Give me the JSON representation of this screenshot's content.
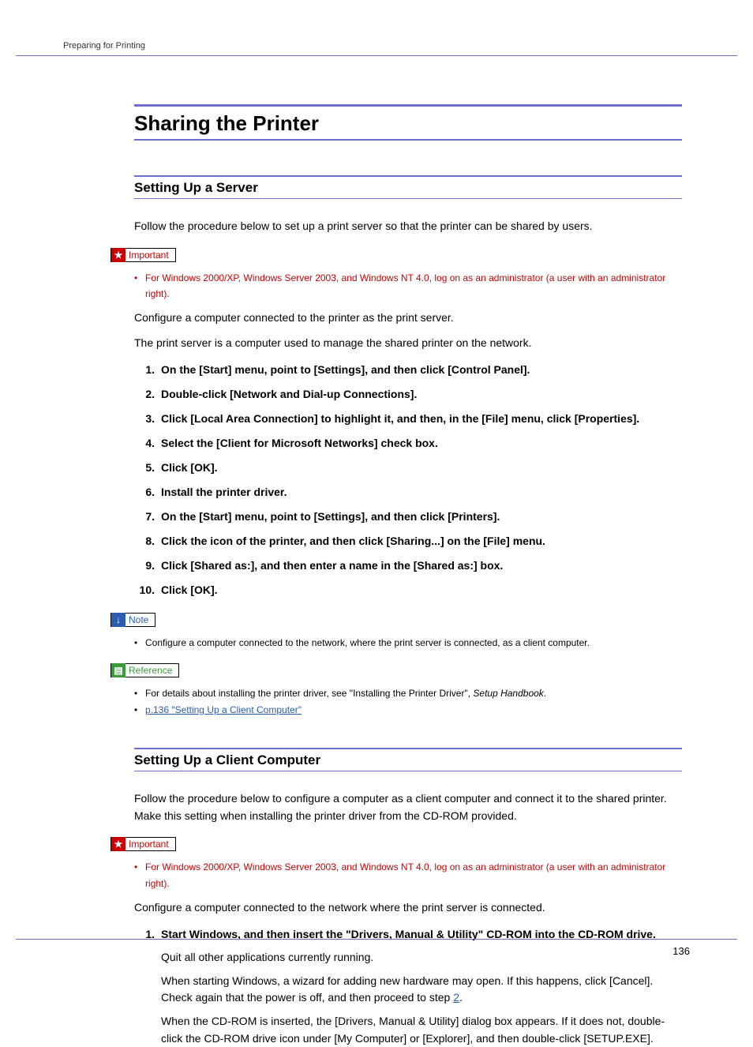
{
  "running_head": "Preparing for Printing",
  "title": "Sharing the Printer",
  "page_number": "136",
  "callouts": {
    "important": "Important",
    "note": "Note",
    "reference": "Reference"
  },
  "section1": {
    "heading": "Setting Up a Server",
    "intro": "Follow the procedure below to set up a print server so that the printer can be shared by users.",
    "important_bullet": "For Windows 2000/XP, Windows Server 2003, and Windows NT 4.0, log on as an administrator (a user with an administrator right).",
    "para2": "Configure a computer connected to the printer as the print server.",
    "para3": "The print server is a computer used to manage the shared printer on the network.",
    "steps": [
      "On the [Start] menu, point to [Settings], and then click [Control Panel].",
      "Double-click [Network and Dial-up Connections].",
      "Click [Local Area Connection] to highlight it, and then, in the [File] menu, click [Properties].",
      "Select the [Client for Microsoft Networks] check box.",
      "Click [OK].",
      "Install the printer driver.",
      "On the [Start] menu, point to [Settings], and then click [Printers].",
      " Click the icon of the printer, and then click [Sharing...] on the [File] menu.",
      "Click [Shared as:], and then enter a name in the [Shared as:] box.",
      "Click [OK]."
    ],
    "note_bullet": "Configure a computer connected to the network, where the print server is connected, as a client computer.",
    "ref_bullet1_a": "For details about installing the printer driver, see \"Installing the Printer Driver\", ",
    "ref_bullet1_b": "Setup Handbook",
    "ref_bullet1_c": ".",
    "ref_link": "p.136 \"Setting Up a Client Computer\""
  },
  "section2": {
    "heading": "Setting Up a Client Computer",
    "intro": "Follow the procedure below to configure a computer as a client computer and connect it to the shared printer. Make this setting when installing the printer driver from the CD-ROM provided.",
    "important_bullet": "For Windows 2000/XP, Windows Server 2003, and Windows NT 4.0, log on as an administrator (a user with an administrator right).",
    "para2": "Configure a computer connected to the network where the print server is connected.",
    "step1": "Start Windows, and then insert the \"Drivers, Manual & Utility\" CD-ROM into the CD-ROM drive.",
    "step1_sub1": "Quit all other applications currently running.",
    "step1_sub2a": "When starting Windows, a wizard for adding new hardware may open. If this happens, click [Cancel]. Check again that the power is off, and then proceed to step ",
    "step1_sub2b": "2",
    "step1_sub2c": ".",
    "step1_sub3": "When the CD-ROM is inserted, the [Drivers, Manual & Utility] dialog box appears. If it does not, double-click the CD-ROM drive icon under [My Computer] or [Explorer], and then double-click [SETUP.EXE]."
  }
}
